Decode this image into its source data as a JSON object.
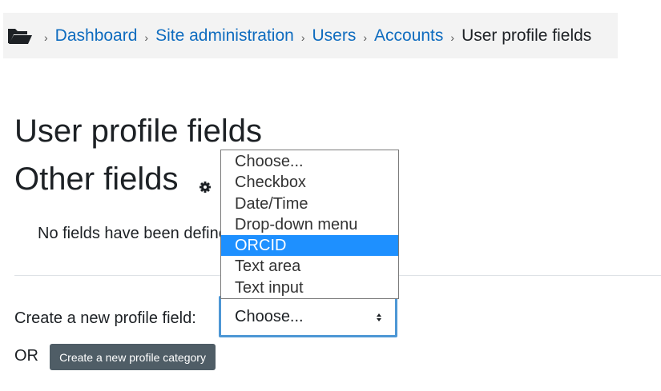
{
  "breadcrumb": {
    "items": [
      {
        "label": "Dashboard"
      },
      {
        "label": "Site administration"
      },
      {
        "label": "Users"
      },
      {
        "label": "Accounts"
      }
    ],
    "current": "User profile fields",
    "separator": "›"
  },
  "page_title": "User profile fields",
  "section": {
    "title": "Other fields",
    "settings_icon": "gear-icon"
  },
  "no_fields_message": "No fields have been defined.",
  "create_field": {
    "label": "Create a new profile field:",
    "selected": "Choose...",
    "options": [
      "Choose...",
      "Checkbox",
      "Date/Time",
      "Drop-down menu",
      "ORCID",
      "Text area",
      "Text input"
    ],
    "highlighted": "ORCID"
  },
  "or_label": "OR",
  "create_category_button": "Create a new profile category",
  "colors": {
    "link": "#0f6cbf",
    "button_bg": "#4f5d66",
    "focus_border": "#4d97d5",
    "highlight": "#1e90ff",
    "breadcrumb_bg": "#f3f3f3"
  }
}
